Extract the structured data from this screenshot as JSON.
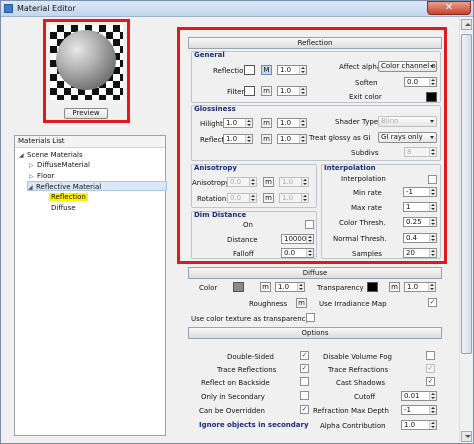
{
  "window": {
    "title": "Material Editor",
    "close_label": "✕"
  },
  "preview": {
    "button_label": "Preview"
  },
  "materials_list": {
    "header": "Materials List",
    "items": [
      {
        "label": "Scene Materials",
        "expander": "◢"
      },
      {
        "label": "DiffuseMaterial",
        "expander": "▷"
      },
      {
        "label": "Floor",
        "expander": "▷"
      },
      {
        "label": "Reflective Material",
        "expander": "◢"
      },
      {
        "label": "Reflection"
      },
      {
        "label": "Diffuse"
      }
    ]
  },
  "reflection": {
    "header": "Reflection",
    "general": {
      "title": "General",
      "reflection_label": "Reflection",
      "reflection_m": "M",
      "reflection_value": "1.0",
      "filter_label": "Filter",
      "filter_m": "m",
      "filter_value": "1.0",
      "affect_alpha_label": "Affect alpha",
      "affect_alpha_value": "Color channel or",
      "soften_label": "Soften",
      "soften_value": "0.0",
      "exit_color_label": "Exit color"
    },
    "glossiness": {
      "title": "Glossiness",
      "hilight_label": "Hilight",
      "hilight_value": "1.0",
      "hilight_m": "m",
      "hilight_value2": "1.0",
      "reflect_label": "Reflect",
      "reflect_value": "1.0",
      "reflect_m": "m",
      "reflect_value2": "1.0",
      "shader_type_label": "Shader Type",
      "shader_type_value": "Blinn",
      "treat_glossy_label": "Treat glossy as GI",
      "treat_glossy_value": "GI rays only",
      "subdivs_label": "Subdivs",
      "subdivs_value": "8"
    },
    "anisotropy": {
      "title": "Anisotropy",
      "anisotropy_label": "Anisotropy",
      "anisotropy_value": "0.0",
      "anisotropy_m": "m",
      "anisotropy_value2": "1.0",
      "rotation_label": "Rotation",
      "rotation_value": "0.0",
      "rotation_m": "m",
      "rotation_value2": "1.0"
    },
    "dim_distance": {
      "title": "Dim Distance",
      "on_label": "On",
      "distance_label": "Distance",
      "distance_value": "100000",
      "falloff_label": "Falloff",
      "falloff_value": "0.0"
    },
    "interpolation": {
      "title": "Interpolation",
      "interp_label": "Interpolation",
      "min_rate_label": "Min rate",
      "min_rate_value": "-1",
      "max_rate_label": "Max rate",
      "max_rate_value": "1",
      "color_thresh_label": "Color Thresh.",
      "color_thresh_value": "0.25",
      "normal_thresh_label": "Normal Thresh.",
      "normal_thresh_value": "0.4",
      "samples_label": "Samples",
      "samples_value": "20"
    }
  },
  "diffuse": {
    "header": "Diffuse",
    "color_label": "Color",
    "color_m": "m",
    "color_value": "1.0",
    "transparency_label": "Transparency",
    "transparency_m": "m",
    "transparency_value": "1.0",
    "roughness_label": "Roughness",
    "roughness_m": "m",
    "irradiance_label": "Use Irradiance Map",
    "use_color_tex_label": "Use color texture as transparency"
  },
  "options": {
    "header": "Options",
    "double_sided": "Double-Sided",
    "trace_reflections": "Trace Reflections",
    "reflect_backside": "Reflect on Backside",
    "only_secondary": "Only in Secondary",
    "can_be_overridden": "Can be Overridden",
    "ignore_objects": "Ignore objects in secondary",
    "disable_volume_fog": "Disable Volume Fog",
    "trace_refractions": "Trace Refractions",
    "cast_shadows": "Cast Shadows",
    "cutoff_label": "Cutoff",
    "cutoff_value": "0.01",
    "refraction_max_depth_label": "Refraction Max Depth",
    "refraction_max_depth_value": "-1",
    "alpha_contribution_label": "Alpha Contribution",
    "alpha_contribution_value": "1.0"
  },
  "colors": {
    "accent_red": "#e01a1a",
    "highlight_yellow": "#fff200",
    "group_title": "#1a2a80"
  }
}
